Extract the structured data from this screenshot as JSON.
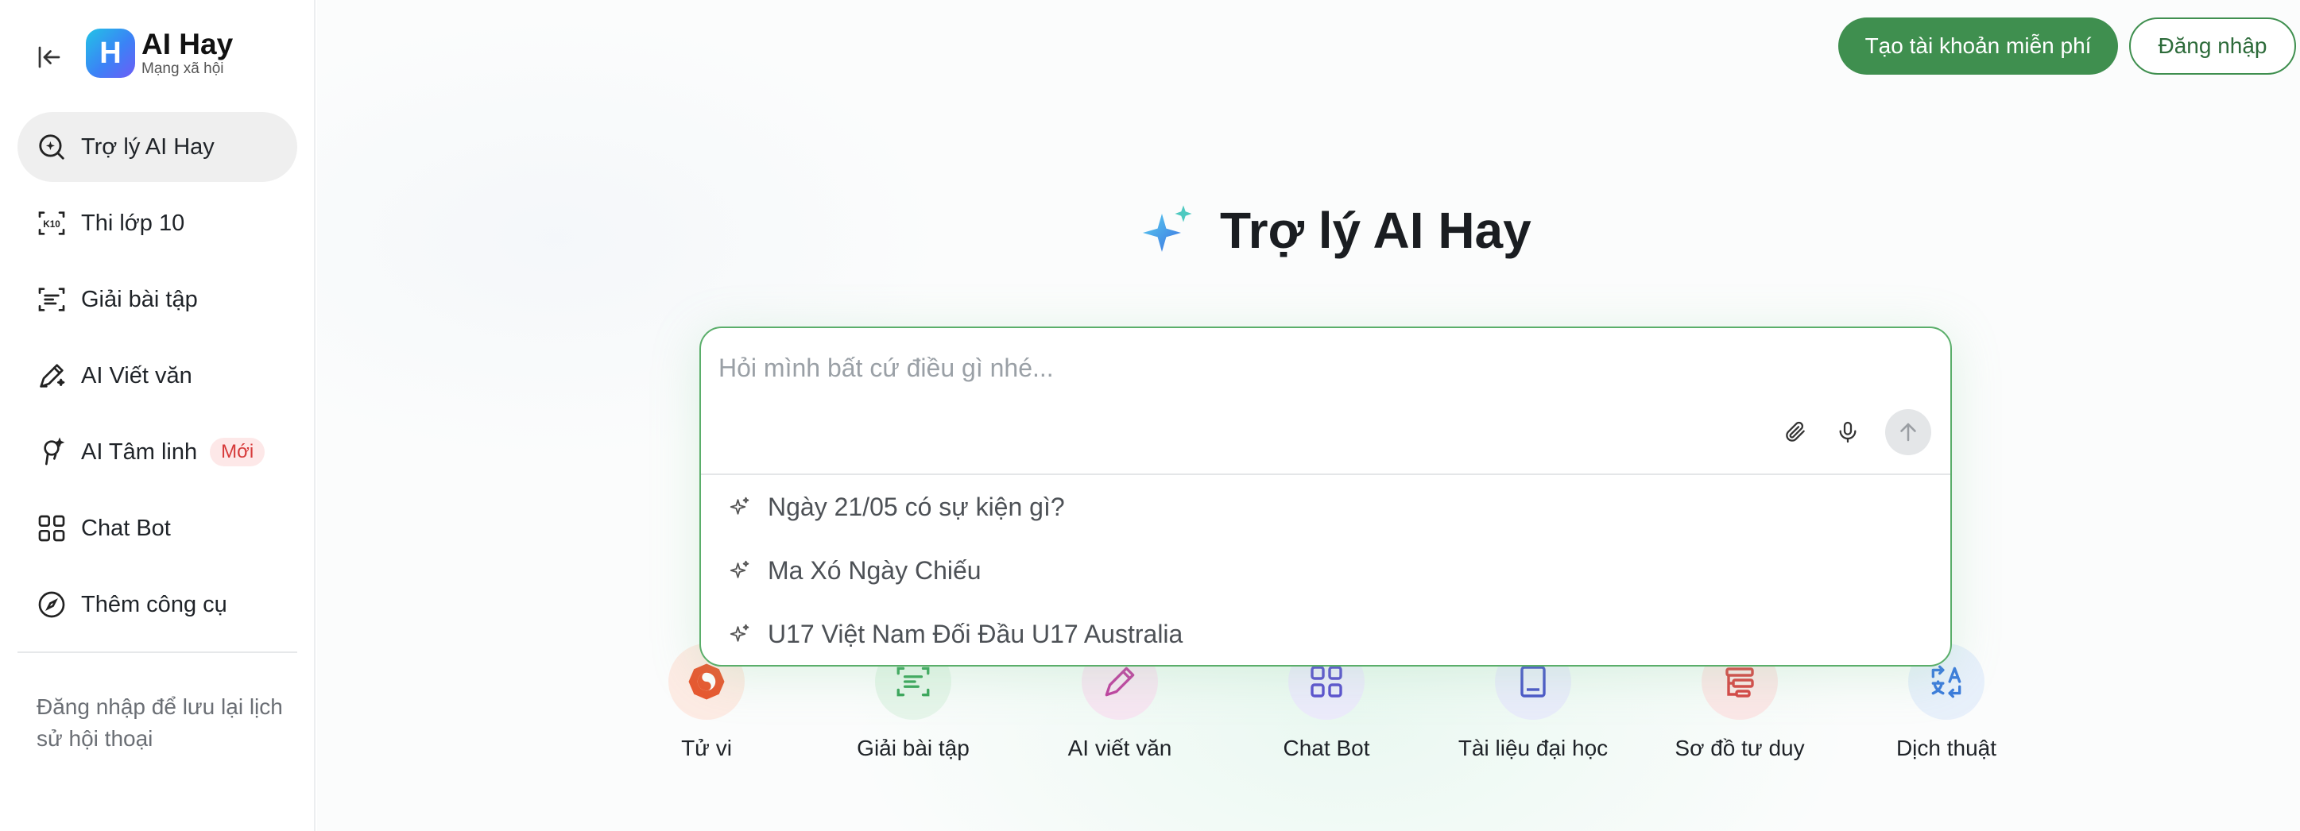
{
  "brand": {
    "name": "AI Hay",
    "tagline": "Mạng xã hội",
    "logo_letter": "H"
  },
  "sidebar": {
    "items": [
      {
        "label": "Trợ lý AI Hay",
        "icon": "ai-search-icon",
        "active": true
      },
      {
        "label": "Thi lớp 10",
        "icon": "k10-icon"
      },
      {
        "label": "Giải bài tập",
        "icon": "scan-text-icon"
      },
      {
        "label": "AI Viết văn",
        "icon": "pen-sparkle-icon"
      },
      {
        "label": "AI Tâm linh",
        "icon": "spiritual-icon",
        "badge": "Mới"
      },
      {
        "label": "Chat Bot",
        "icon": "apps-icon"
      },
      {
        "label": "Thêm công cụ",
        "icon": "compass-icon"
      }
    ],
    "login_hint": "Đăng nhập để lưu lại lịch sử hội thoại"
  },
  "header": {
    "signup_label": "Tạo tài khoản miễn phí",
    "login_label": "Đăng nhập"
  },
  "hero": {
    "title": "Trợ lý AI Hay"
  },
  "chat": {
    "placeholder": "Hỏi mình bất cứ điều gì nhé...",
    "value": "",
    "suggestions": [
      "Ngày 21/05 có sự kiện gì?",
      "Ma Xó Ngày Chiếu",
      "U17 Việt Nam Đối Đầu U17 Australia"
    ]
  },
  "tools": [
    {
      "label": "Tử vi",
      "icon": "horoscope-icon",
      "color": "#e8572f"
    },
    {
      "label": "Giải bài tập",
      "icon": "scan-text-icon",
      "color": "#3aa55a"
    },
    {
      "label": "AI viết văn",
      "icon": "pen-sparkle-icon",
      "color": "#c040a0"
    },
    {
      "label": "Chat Bot",
      "icon": "apps-icon",
      "color": "#5a4fcf"
    },
    {
      "label": "Tài liệu đại học",
      "icon": "book-icon",
      "color": "#4a55c8"
    },
    {
      "label": "Sơ đồ tư duy",
      "icon": "mindmap-icon",
      "color": "#d64545"
    },
    {
      "label": "Dịch thuật",
      "icon": "translate-icon",
      "color": "#3b7bdc"
    }
  ],
  "colors": {
    "primary": "#3f8f4f",
    "accent_border": "#5aae6a",
    "badge_bg": "#fde8e8",
    "badge_text": "#d63a3a"
  }
}
